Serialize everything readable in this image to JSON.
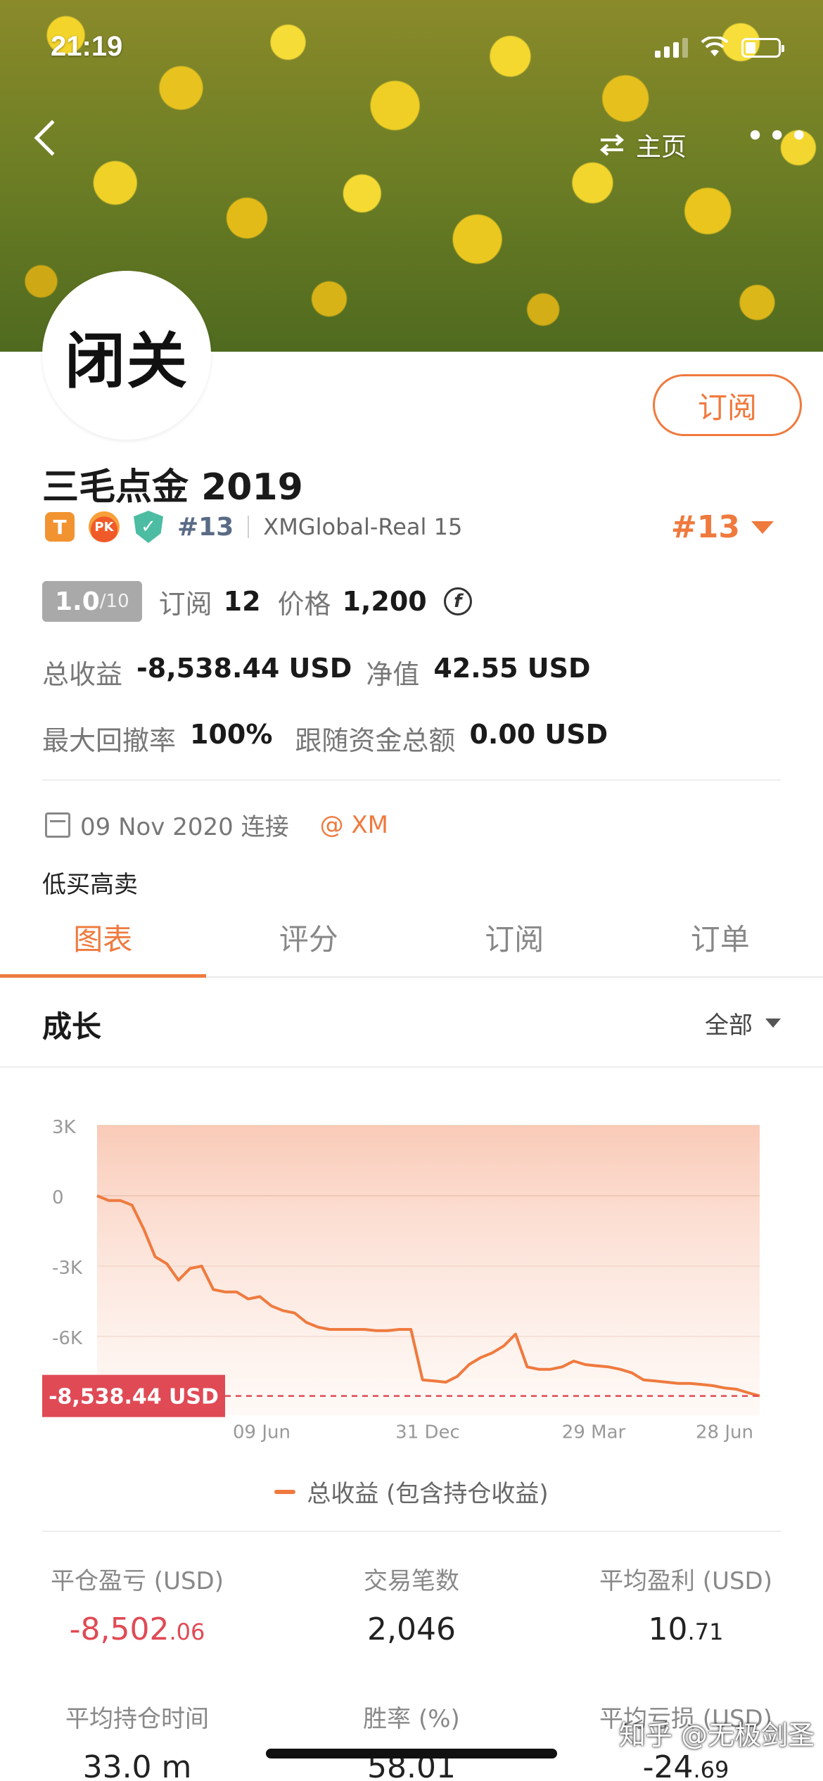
{
  "status_bar": {
    "time": "21:19"
  },
  "nav": {
    "home_label": "主页",
    "more_label": "•••"
  },
  "profile": {
    "avatar_text": "闭关",
    "subscribe_label": "订阅",
    "name": "三毛点金 2019",
    "badge_t": "T",
    "badge_pk": "PK",
    "rank_small": "#13",
    "account": "XMGlobal-Real 15",
    "rank_big": "#13",
    "score": "1.0",
    "score_suffix": "/10",
    "subscriptions_label": "订阅",
    "subscriptions_value": "12",
    "price_label": "价格",
    "price_value": "1,200",
    "total_profit_label": "总收益",
    "total_profit_value": "-8,538.44 USD",
    "equity_label": "净值",
    "equity_value": "42.55 USD",
    "max_drawdown_label": "最大回撤率",
    "max_drawdown_value": "100%",
    "follow_funds_label": "跟随资金总额",
    "follow_funds_value": "0.00 USD",
    "connect_date": "09 Nov 2020 连接",
    "broker": "@ XM",
    "motto": "低买高卖"
  },
  "tabs": [
    "图表",
    "评分",
    "订阅",
    "订单"
  ],
  "active_tab": 0,
  "section": {
    "title": "成长",
    "filter": "全部"
  },
  "chart_data": {
    "type": "area",
    "title": "",
    "y_ticks": [
      "3K",
      "0",
      "-3K",
      "-6K"
    ],
    "x_ticks": [
      "09 Jun",
      "31 Dec",
      "29 Mar",
      "28 Jun"
    ],
    "ylim": [
      -9000,
      3000
    ],
    "series": [
      {
        "name": "总收益 (包含持仓收益)",
        "color": "#ef7a3e",
        "values": [
          0,
          -200,
          -200,
          -400,
          -1400,
          -2600,
          -2900,
          -3600,
          -3100,
          -3000,
          -4000,
          -4100,
          -4100,
          -4400,
          -4300,
          -4700,
          -4900,
          -5000,
          -5400,
          -5600,
          -5700,
          -5700,
          -5700,
          -5700,
          -5750,
          -5750,
          -5700,
          -5700,
          -7850,
          -7900,
          -7950,
          -7700,
          -7200,
          -6900,
          -6700,
          -6400,
          -5900,
          -7300,
          -7400,
          -7400,
          -7300,
          -7050,
          -7200,
          -7250,
          -7300,
          -7400,
          -7550,
          -7850,
          -7900,
          -7950,
          -8000,
          -8000,
          -8050,
          -8100,
          -8200,
          -8250,
          -8400,
          -8538.44
        ]
      }
    ],
    "current_value_label": "-8,538.44 USD",
    "current_value": -8538.44
  },
  "legend": {
    "label": "总收益 (包含持仓收益)"
  },
  "stats": [
    {
      "label": "平仓盈亏 (USD)",
      "int": "-8,502",
      "dec": ".06",
      "negative": true
    },
    {
      "label": "交易笔数",
      "int": "2,046",
      "dec": "",
      "negative": false
    },
    {
      "label": "平均盈利 (USD)",
      "int": "10",
      "dec": ".71",
      "negative": false
    },
    {
      "label": "平均持仓时间",
      "int": "33.0 m",
      "dec": "",
      "negative": false
    },
    {
      "label": "胜率 (%)",
      "int": "58.01",
      "dec": "",
      "negative": false
    },
    {
      "label": "平均亏损 (USD)",
      "int": "-24",
      "dec": ".69",
      "negative": false
    }
  ],
  "watermark": "知乎 @无极剑圣",
  "colors": {
    "accent": "#ef7a3e",
    "negative": "#e04a55",
    "badge_green": "#4cbca2"
  }
}
